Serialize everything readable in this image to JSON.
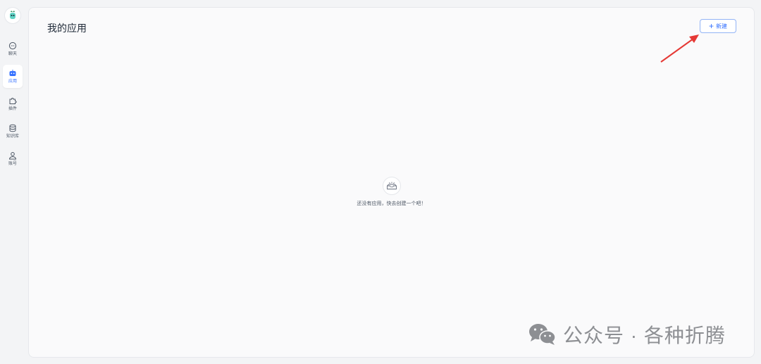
{
  "sidebar": {
    "logo_icon": "app-logo-icon",
    "items": [
      {
        "label": "聊天",
        "icon": "chat-icon",
        "active": false
      },
      {
        "label": "应用",
        "icon": "robot-icon",
        "active": true
      },
      {
        "label": "插件",
        "icon": "puzzle-icon",
        "active": false
      },
      {
        "label": "知识库",
        "icon": "database-icon",
        "active": false
      },
      {
        "label": "账号",
        "icon": "user-icon",
        "active": false
      }
    ]
  },
  "main": {
    "title": "我的应用",
    "new_button_label": "新建",
    "empty_icon": "empty-box-icon",
    "empty_text": "还没有应用，快去创建一个吧！"
  },
  "watermark": {
    "text": "公众号 · 各种折腾",
    "icon": "wechat-icon"
  },
  "colors": {
    "accent": "#3370ff",
    "annotation_arrow": "#e53935"
  }
}
